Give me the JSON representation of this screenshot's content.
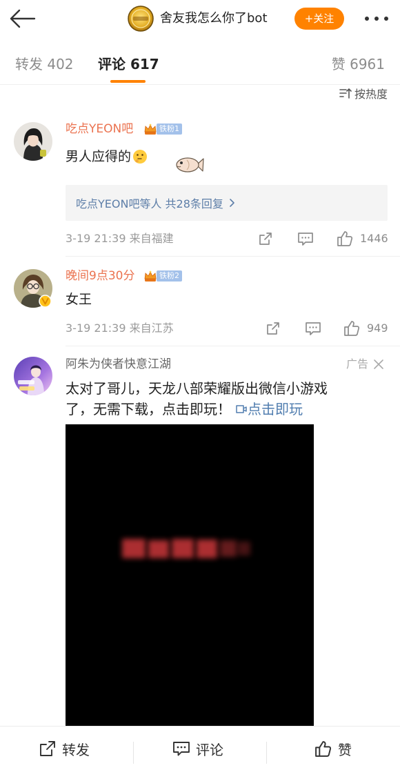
{
  "header": {
    "title": "舍友我怎么你了bot",
    "follow_label": "+关注"
  },
  "tabs": [
    {
      "label": "转发",
      "count": "402",
      "active": false
    },
    {
      "label": "评论",
      "count": "617",
      "active": true
    },
    {
      "label": "赞",
      "count": "6961",
      "active": false
    }
  ],
  "sort": {
    "label": "按热度",
    "icon": "sort-icon"
  },
  "comments": [
    {
      "username": "吃点YEON吧",
      "fan_badge": "铁粉1",
      "text": "男人应得的",
      "reply_summary": {
        "users": "吃点YEON吧等人",
        "count_text": "共28条回复"
      },
      "time": "3-19 21:39",
      "location": "来自福建",
      "likes": "1446"
    },
    {
      "username": "晚间9点30分",
      "fan_badge": "铁粉2",
      "text": "女王",
      "verified": true,
      "time": "3-19 21:39",
      "location": "来自江苏",
      "likes": "949"
    }
  ],
  "ad": {
    "username": "阿朱为侠者快意江湖",
    "ad_label": "广告",
    "text_lines": [
      "太对了哥儿，天龙八部荣耀版出微信小游戏",
      "了，无需下载，点击即玩！"
    ],
    "link_label": "点击即玩"
  },
  "bottom_bar": [
    {
      "label": "转发",
      "icon": "repost-icon"
    },
    {
      "label": "评论",
      "icon": "comment-icon"
    },
    {
      "label": "赞",
      "icon": "like-icon"
    }
  ],
  "colors": {
    "accent": "#ff8200",
    "username": "#eb7350",
    "link": "#507daf",
    "reply_link": "#5d7ea8",
    "meta": "#9a9a9a"
  }
}
